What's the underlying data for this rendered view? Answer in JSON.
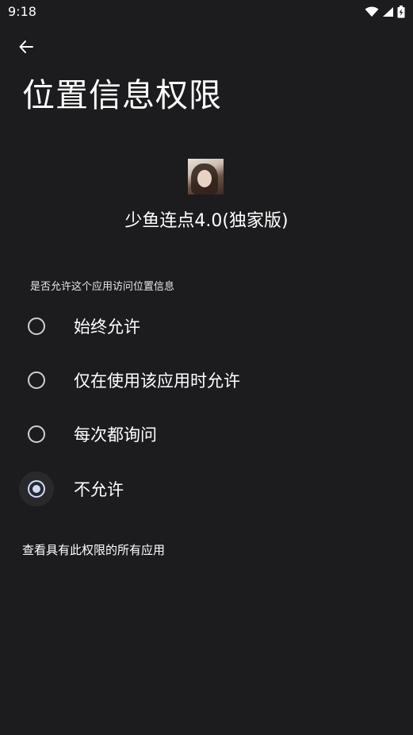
{
  "status_bar": {
    "time": "9:18",
    "icons": [
      "wifi-icon",
      "cell-signal-icon",
      "battery-charging-icon"
    ]
  },
  "header": {
    "back_icon": "arrow-left-icon",
    "title": "位置信息权限"
  },
  "app": {
    "icon": "app-avatar-image",
    "name": "少鱼连点4.0(独家版)"
  },
  "permission": {
    "question": "是否允许这个应用访问位置信息",
    "options": [
      {
        "label": "始终允许",
        "selected": false
      },
      {
        "label": "仅在使用该应用时允许",
        "selected": false
      },
      {
        "label": "每次都询问",
        "selected": false
      },
      {
        "label": "不允许",
        "selected": true
      }
    ]
  },
  "footer": {
    "view_all_label": "查看具有此权限的所有应用"
  },
  "colors": {
    "background": "#1c1c1e",
    "text": "#ffffff",
    "accent": "#cfd8ff"
  }
}
